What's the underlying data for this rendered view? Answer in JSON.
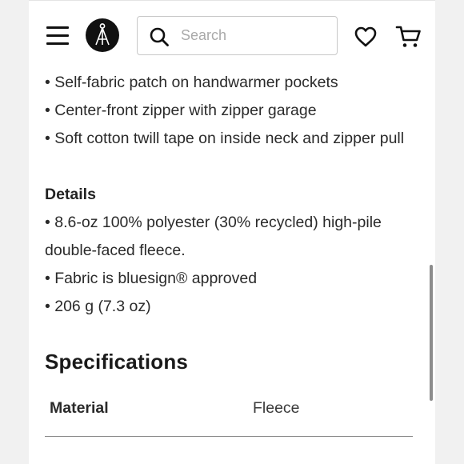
{
  "header": {
    "search_placeholder": "Search",
    "icons": [
      "menu-icon",
      "logo-icon",
      "search-icon",
      "heart-icon",
      "cart-icon"
    ]
  },
  "features": [
    "• Self-fabric patch on handwarmer pockets",
    "• Center-front zipper with zipper garage",
    "• Soft cotton twill tape on inside neck and zipper pull"
  ],
  "details": {
    "heading": "Details",
    "items": [
      "• 8.6-oz 100% polyester (30% recycled) high-pile double-faced fleece.",
      "• Fabric is bluesign® approved",
      "• 206 g (7.3 oz)"
    ]
  },
  "specifications": {
    "heading": "Specifications",
    "rows": [
      {
        "key": "Material",
        "value": "Fleece"
      }
    ]
  }
}
